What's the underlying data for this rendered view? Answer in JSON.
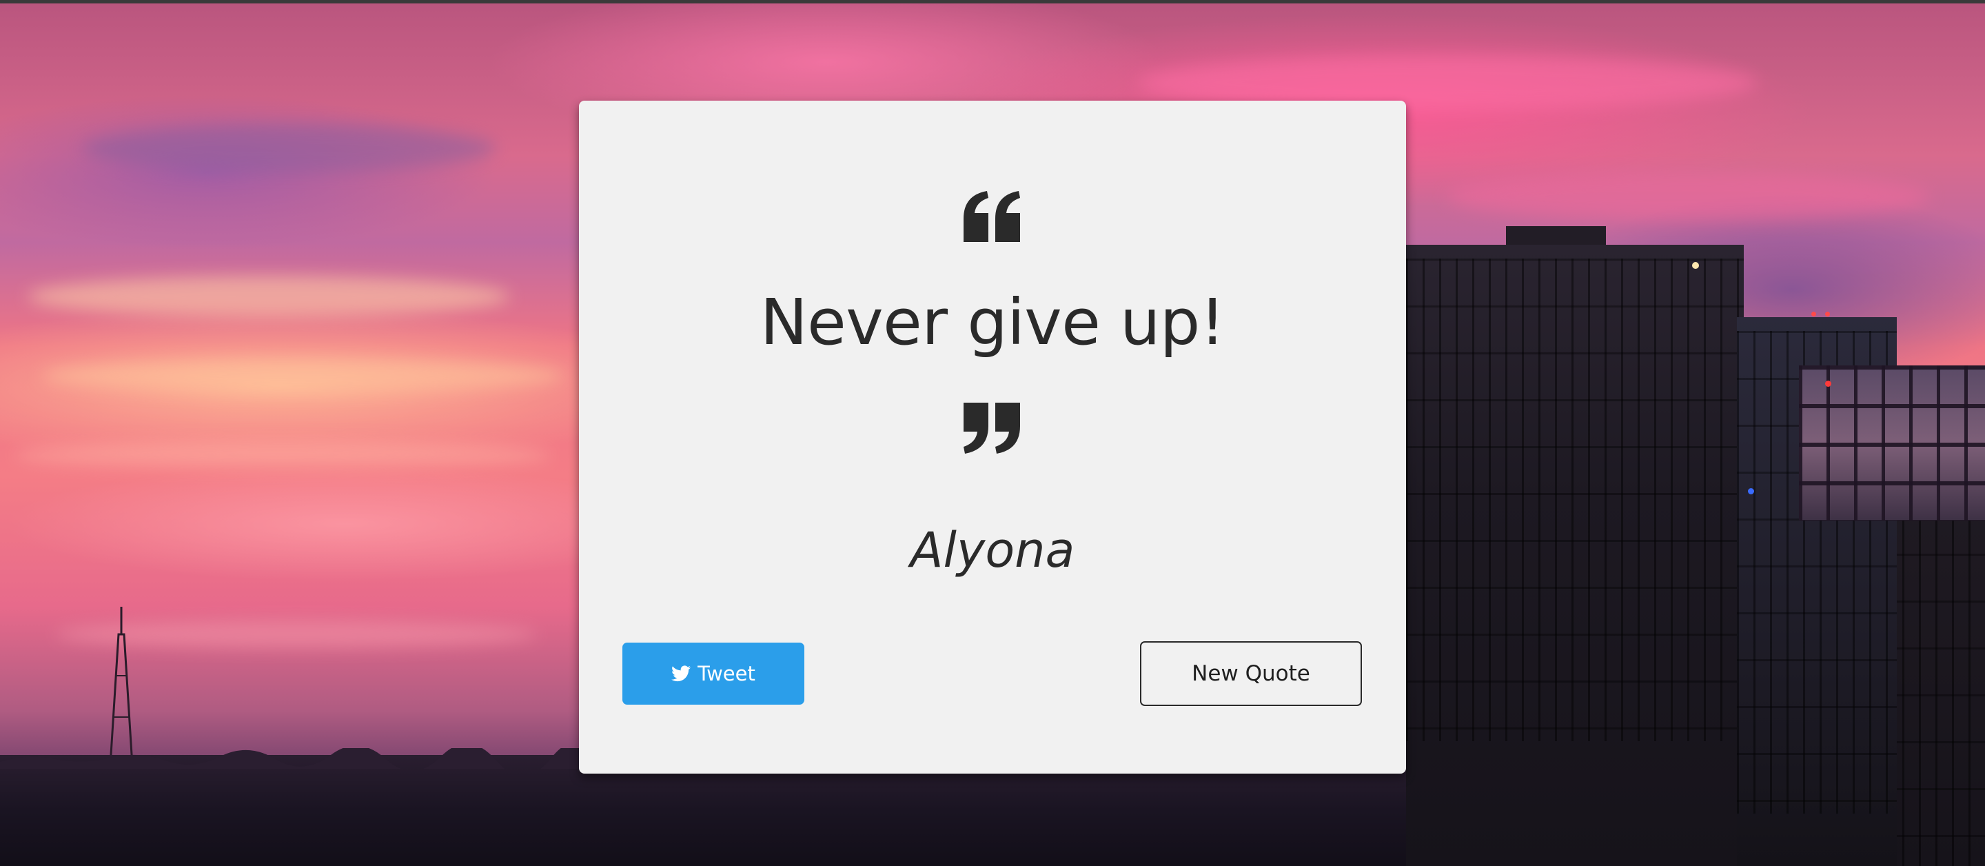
{
  "quote": {
    "text": "Never give up!",
    "author": "Alyona",
    "open_icon": "quote-left-icon",
    "close_icon": "quote-right-icon"
  },
  "actions": {
    "tweet_label": "Tweet",
    "tweet_icon": "twitter-bird-icon",
    "new_quote_label": "New Quote"
  },
  "colors": {
    "card_background": "#f1f1f1",
    "text": "#2a2a2a",
    "tweet_button": "#2b9eea"
  },
  "background": {
    "icon": "sunset-city-background"
  }
}
